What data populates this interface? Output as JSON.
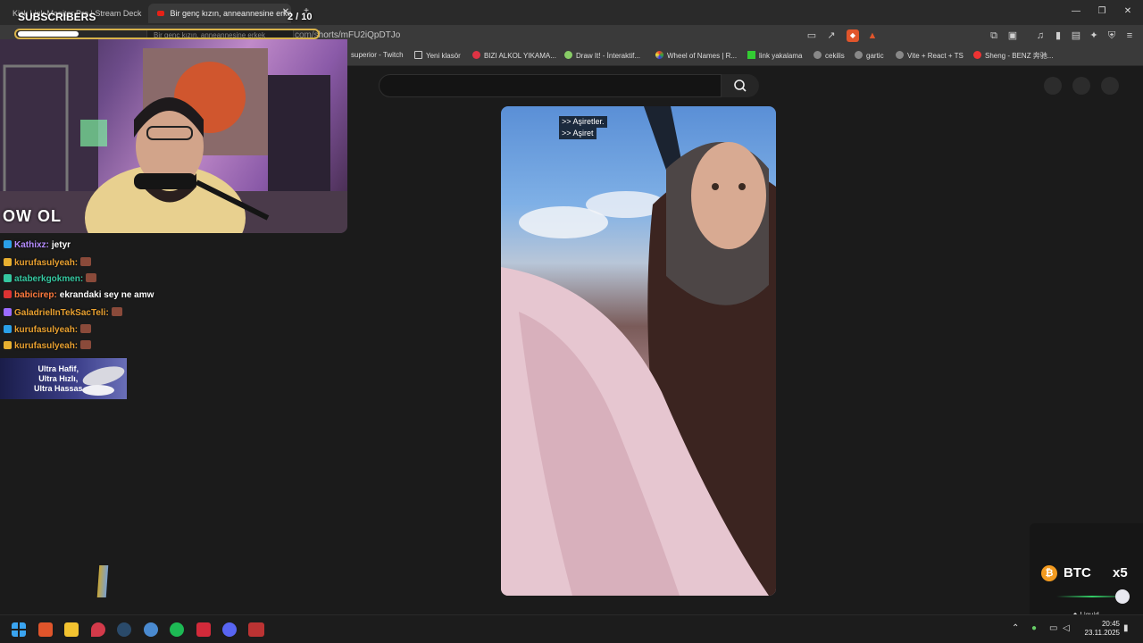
{
  "tabs": [
    {
      "label": "Kick Link Monitor Pro | Stream Deck"
    },
    {
      "label": "Bir genç kızın, anneannesine erkek..."
    }
  ],
  "tooltip": "Bir genç kızın, anneannesine erkek",
  "address": {
    "url": "com/shorts/mFU2iQpDTJo"
  },
  "bookmarks": [
    {
      "label": "superior - Twitch"
    },
    {
      "label": "Yeni klasör"
    },
    {
      "label": "BIZI ALKOL YIKAMA..."
    },
    {
      "label": "Draw It! - İnteraktif..."
    },
    {
      "label": "Wheel of Names | R..."
    },
    {
      "label": "link yakalama"
    },
    {
      "label": "cekilis"
    },
    {
      "label": "gartic"
    },
    {
      "label": "Vite + React + TS"
    },
    {
      "label": "Sheng - BENZ 奔驰..."
    }
  ],
  "overlay": {
    "subs_label": "SUBSCRIBERS",
    "subs_count": "2 / 10",
    "subs_progress": 0.2,
    "webcam_logo": "OW OL"
  },
  "video": {
    "captions": [
      ">> Aşiretler.",
      ">> Aşiret"
    ]
  },
  "chat": [
    {
      "user": "Kathixz:",
      "msg": "jetyr",
      "color": "#b58cff"
    },
    {
      "user": "kurufasulyeah:",
      "msg": "",
      "color": "#e8a030"
    },
    {
      "user": "ataberkgokmen:",
      "msg": "",
      "color": "#35c7a0"
    },
    {
      "user": "babicirep:",
      "msg": "ekrandaki sey ne amw",
      "color": "#ff7a3d"
    },
    {
      "user": "GaladrielInTekSacTeli:",
      "msg": "",
      "color": "#e8a030"
    },
    {
      "user": "kurufasulyeah:",
      "msg": "",
      "color": "#e8a030"
    },
    {
      "user": "kurufasulyeah:",
      "msg": "",
      "color": "#e8a030"
    }
  ],
  "ad": {
    "text": "Ultra Hafif,\nUltra Hızlı,\nUltra Hassas"
  },
  "btc": {
    "ticker": "BTC",
    "multiplier": "x5",
    "brand": "Liquid"
  },
  "clock": {
    "time": "20:45",
    "date": "23.11.2025"
  }
}
